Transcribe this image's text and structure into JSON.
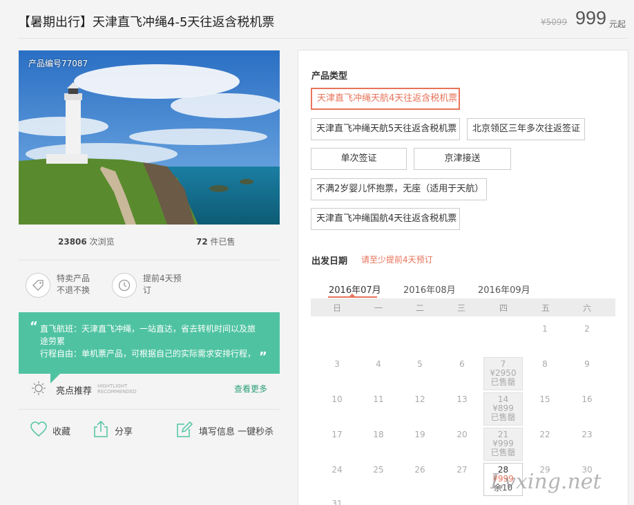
{
  "header": {
    "title": "【暑期出行】天津直飞冲绳4-5天往返含税机票",
    "original_price": "¥5099",
    "price": "999",
    "price_unit": "元起"
  },
  "photo": {
    "product_no": "产品编号77087"
  },
  "stats": {
    "views_num": "23806",
    "views_label": "次浏览",
    "sold_num": "72",
    "sold_label": "件已售"
  },
  "features": [
    {
      "icon": "tag-icon",
      "line1": "特卖产品",
      "line2": "不退不换"
    },
    {
      "icon": "clock-icon",
      "line1": "提前4天预",
      "line2": "订"
    }
  ],
  "highlight": {
    "text1": "直飞航班：天津直飞冲绳，一站直达，省去转机时间以及旅途劳累",
    "text2": "行程自由：单机票产品，可根据自己的实际需求安排行程，",
    "label": "亮点推荐",
    "label_en1": "HIGHTLIGHT",
    "label_en2": "RECOMMENDED",
    "see_more": "查看更多"
  },
  "actions": [
    {
      "icon": "heart-icon",
      "label": "收藏"
    },
    {
      "icon": "share-icon",
      "label": "分享"
    },
    {
      "icon": "edit-icon",
      "label": "填写信息 一键秒杀"
    }
  ],
  "product_types": {
    "title": "产品类型",
    "options": [
      "天津直飞冲绳天航4天往返含税机票",
      "天津直飞冲绳天航5天往返含税机票",
      "北京领区三年多次往返签证",
      "单次签证",
      "京津接送",
      "不满2岁婴儿怀抱票，无座（适用于天航）",
      "天津直飞冲绳国航4天往返含税机票"
    ],
    "selected": "天津直飞冲绳天航4天往返含税机票"
  },
  "departure": {
    "title": "出发日期",
    "notice": "请至少提前4天预订",
    "months": [
      "2016年07月",
      "2016年08月",
      "2016年09月"
    ],
    "active_month": "2016年07月",
    "weekdays": [
      "日",
      "一",
      "二",
      "三",
      "四",
      "五",
      "六"
    ],
    "days": {
      "d1": "1",
      "d2": "2",
      "d3": "3",
      "d4": "4",
      "d5": "5",
      "d6": "6",
      "d8": "8",
      "d9": "9",
      "d10": "10",
      "d11": "11",
      "d12": "12",
      "d13": "13",
      "d15": "15",
      "d16": "16",
      "d17": "17",
      "d18": "18",
      "d19": "19",
      "d20": "20",
      "d22": "22",
      "d23": "23",
      "d24": "24",
      "d25": "25",
      "d26": "26",
      "d27": "27",
      "d29": "29",
      "d30": "30",
      "d31": "31"
    },
    "priced_days": [
      {
        "day": "7",
        "price": "¥2950",
        "status": "已售罄"
      },
      {
        "day": "14",
        "price": "¥899",
        "status": "已售罄"
      },
      {
        "day": "21",
        "price": "¥999",
        "status": "已售罄"
      },
      {
        "day": "28",
        "price": "¥999",
        "status": "余10"
      }
    ]
  },
  "watermark": "Lvxing.net",
  "colors": {
    "accent": "#e8735a",
    "teal": "#4fc3a1",
    "link": "#2c9e7a"
  }
}
